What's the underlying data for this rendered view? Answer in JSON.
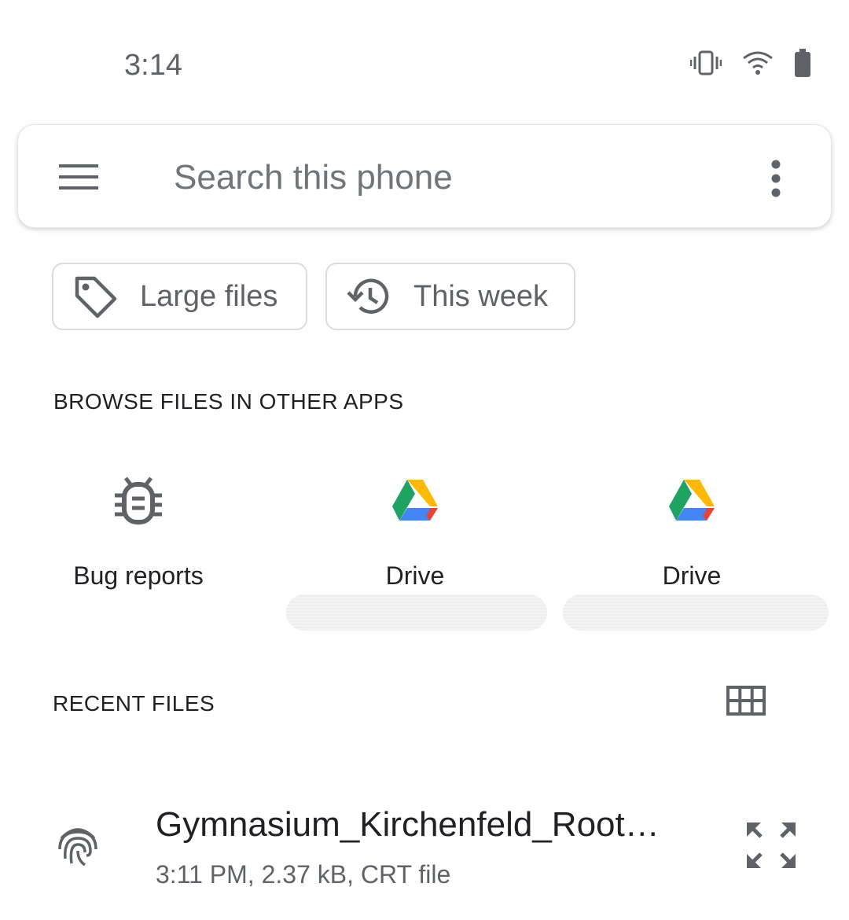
{
  "status_bar": {
    "time": "3:14",
    "icons": [
      "vibrate-icon",
      "wifi-icon",
      "battery-icon"
    ]
  },
  "search": {
    "placeholder": "Search this phone",
    "menu_icon": "hamburger-menu-icon",
    "more_icon": "more-vert-icon"
  },
  "chips": [
    {
      "label": "Large files",
      "icon": "tag-icon"
    },
    {
      "label": "This week",
      "icon": "history-icon"
    }
  ],
  "browse": {
    "title": "BROWSE FILES IN OTHER APPS",
    "apps": [
      {
        "label": "Bug reports",
        "icon": "bug-icon"
      },
      {
        "label": "Drive",
        "icon": "google-drive-icon"
      },
      {
        "label": "Drive",
        "icon": "google-drive-icon"
      }
    ]
  },
  "recent": {
    "title": "RECENT FILES",
    "view_toggle_icon": "grid-view-icon",
    "files": [
      {
        "name": "Gymnasium_Kirchenfeld_Root…",
        "meta": "3:11 PM, 2.37 kB, CRT file",
        "icon": "fingerprint-icon",
        "action_icon": "expand-icon"
      }
    ]
  },
  "colors": {
    "icon_gray": "#5f6368",
    "drive_green": "#1ea362",
    "drive_yellow": "#ffba00",
    "drive_blue": "#4285f4",
    "drive_red": "#ea4335"
  }
}
